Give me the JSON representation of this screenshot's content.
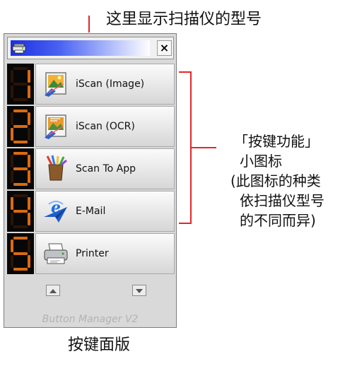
{
  "annotations": {
    "model_caption": "这里显示扫描仪的型号",
    "button_icon_lines": [
      "「按键功能」",
      "小图标",
      "(此图标的种类",
      "依扫描仪型号",
      "的不同而异)"
    ],
    "panel_caption": "按键面版"
  },
  "window": {
    "close_label": "×",
    "buttons": [
      {
        "label": "iScan (Image)",
        "icon": "image-scan-icon"
      },
      {
        "label": "iScan (OCR)",
        "icon": "ocr-scan-icon"
      },
      {
        "label": "Scan To App",
        "icon": "application-icon"
      },
      {
        "label": "E-Mail",
        "icon": "email-icon"
      },
      {
        "label": "Printer",
        "icon": "printer-icon"
      }
    ],
    "digits": [
      "1",
      "2",
      "3",
      "4",
      "5"
    ],
    "nav": {
      "up_icon": "triangle-up-icon",
      "down_icon": "triangle-down-icon"
    },
    "footer": "Button Manager V2"
  },
  "colors": {
    "annotation_line": "#e3262c",
    "model_bar": "#1c2fe0",
    "digit_segment": "#d96b0f"
  }
}
